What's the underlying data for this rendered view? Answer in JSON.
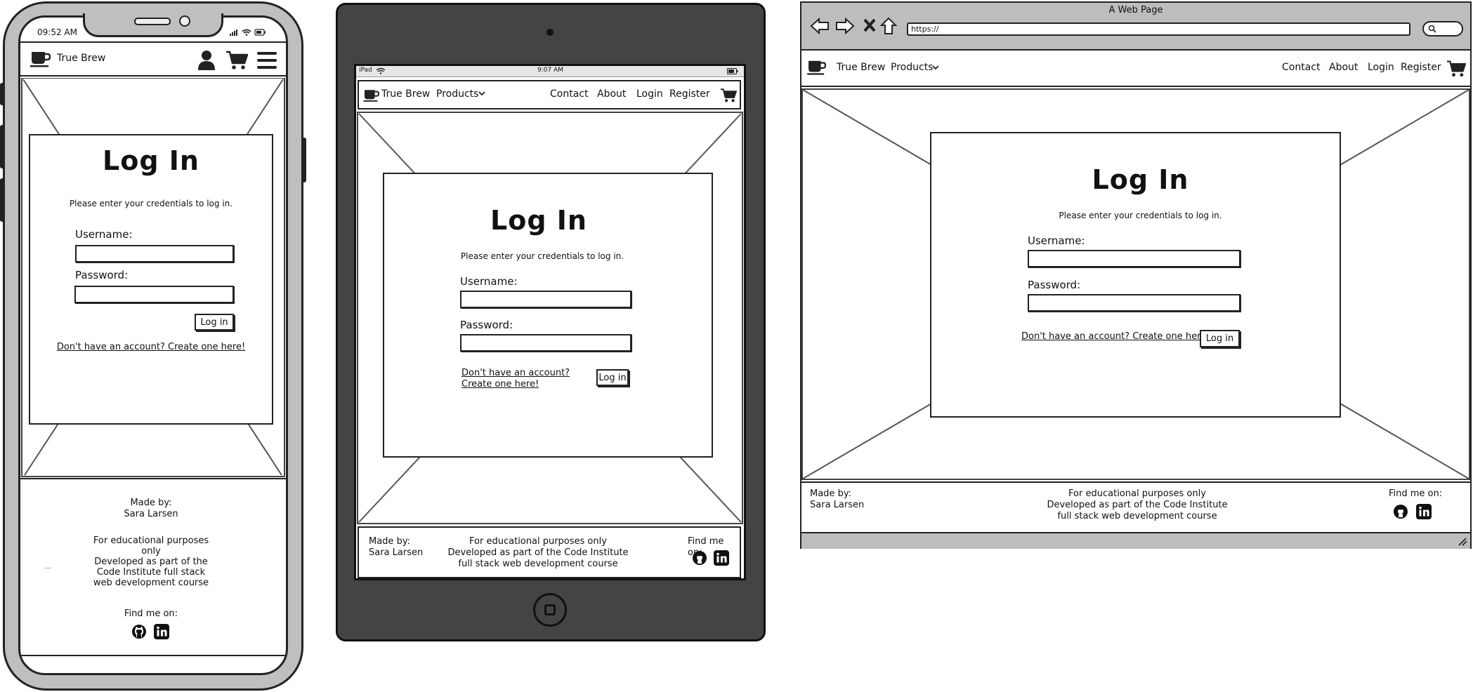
{
  "brand": {
    "name": "True Brew"
  },
  "nav": {
    "products": "Products",
    "contact": "Contact",
    "about": "About",
    "login": "Login",
    "register": "Register"
  },
  "login_form": {
    "title": "Log In",
    "instructions": "Please enter your credentials to log in.",
    "username_label": "Username:",
    "password_label": "Password:",
    "submit_label": "Log in",
    "signup_link": "Don't have an account? Create one here!",
    "signup_link_line1": "Don't have an account?",
    "signup_link_line2": "Create one here!"
  },
  "footer": {
    "made_by_label": "Made by:",
    "author": "Sara Larsen",
    "edu_line1": "For educational purposes only",
    "edu_line2": "Developed as part of the Code Institute",
    "edu_line3": "full stack web development course",
    "mobile_edu_lines": [
      "For educational purposes",
      "only",
      "Developed as part of the",
      "Code Institute full stack",
      "web development course"
    ],
    "mobile_ellipsis": "...",
    "find_me": "Find me on:"
  },
  "phone": {
    "status_time": "09:52 AM"
  },
  "tablet": {
    "status_device": "iPad",
    "status_time": "9:07 AM"
  },
  "browser": {
    "window_title": "A Web Page",
    "url": "https://"
  },
  "icons": {
    "logo": "coffee-cup-icon",
    "user": "user-icon",
    "cart": "cart-icon",
    "menu": "hamburger-menu-icon",
    "github": "github-icon",
    "linkedin": "linkedin-icon",
    "back": "back-arrow-icon",
    "forward": "forward-arrow-icon",
    "stop": "close-icon",
    "home": "home-icon",
    "search": "search-icon",
    "chevron": "chevron-down-icon",
    "home_button": "home-button-icon",
    "camera": "camera-icon"
  }
}
